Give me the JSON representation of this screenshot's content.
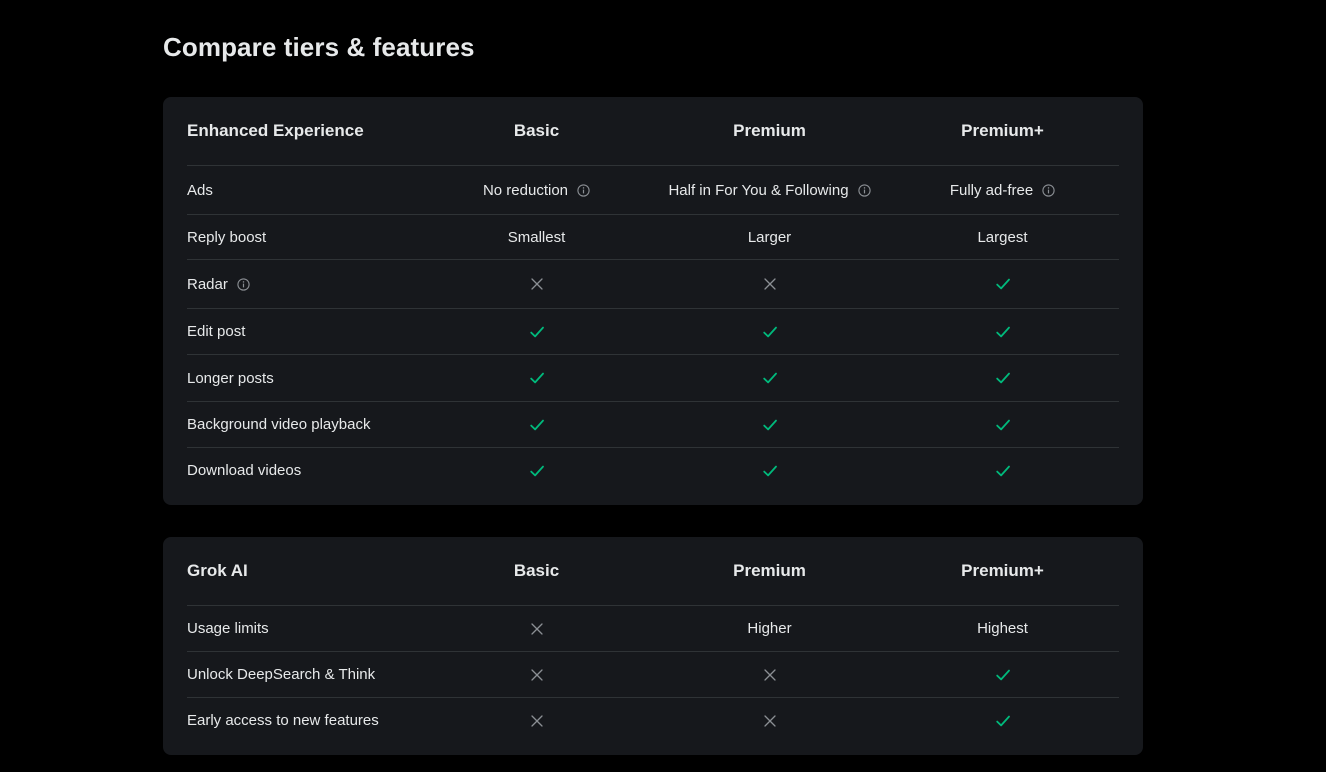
{
  "page_title": "Compare tiers & features",
  "colors": {
    "background": "#000000",
    "card": "#16181c",
    "divider": "#2f3336",
    "text": "#e7e9ea",
    "check": "#00ba7c",
    "cross": "#8b8f94"
  },
  "sections": [
    {
      "title": "Enhanced Experience",
      "columns": [
        "Basic",
        "Premium",
        "Premium+"
      ],
      "rows": [
        {
          "feature": "Ads",
          "info": false,
          "cells": [
            {
              "type": "text",
              "text": "No reduction",
              "info": true
            },
            {
              "type": "text",
              "text": "Half in For You & Following",
              "info": true
            },
            {
              "type": "text",
              "text": "Fully ad-free",
              "info": true
            }
          ]
        },
        {
          "feature": "Reply boost",
          "info": false,
          "cells": [
            {
              "type": "text",
              "text": "Smallest",
              "info": false
            },
            {
              "type": "text",
              "text": "Larger",
              "info": false
            },
            {
              "type": "text",
              "text": "Largest",
              "info": false
            }
          ]
        },
        {
          "feature": "Radar",
          "info": true,
          "cells": [
            {
              "type": "cross",
              "icon": "x-icon"
            },
            {
              "type": "cross",
              "icon": "x-icon"
            },
            {
              "type": "check",
              "icon": "check-icon"
            }
          ]
        },
        {
          "feature": "Edit post",
          "info": false,
          "cells": [
            {
              "type": "check",
              "icon": "check-icon"
            },
            {
              "type": "check",
              "icon": "check-icon"
            },
            {
              "type": "check",
              "icon": "check-icon"
            }
          ]
        },
        {
          "feature": "Longer posts",
          "info": false,
          "cells": [
            {
              "type": "check",
              "icon": "check-icon"
            },
            {
              "type": "check",
              "icon": "check-icon"
            },
            {
              "type": "check",
              "icon": "check-icon"
            }
          ]
        },
        {
          "feature": "Background video playback",
          "info": false,
          "cells": [
            {
              "type": "check",
              "icon": "check-icon"
            },
            {
              "type": "check",
              "icon": "check-icon"
            },
            {
              "type": "check",
              "icon": "check-icon"
            }
          ]
        },
        {
          "feature": "Download videos",
          "info": false,
          "cells": [
            {
              "type": "check",
              "icon": "check-icon"
            },
            {
              "type": "check",
              "icon": "check-icon"
            },
            {
              "type": "check",
              "icon": "check-icon"
            }
          ]
        }
      ]
    },
    {
      "title": "Grok AI",
      "columns": [
        "Basic",
        "Premium",
        "Premium+"
      ],
      "rows": [
        {
          "feature": "Usage limits",
          "info": false,
          "cells": [
            {
              "type": "cross",
              "icon": "x-icon"
            },
            {
              "type": "text",
              "text": "Higher",
              "info": false
            },
            {
              "type": "text",
              "text": "Highest",
              "info": false
            }
          ]
        },
        {
          "feature": "Unlock DeepSearch & Think",
          "info": false,
          "cells": [
            {
              "type": "cross",
              "icon": "x-icon"
            },
            {
              "type": "cross",
              "icon": "x-icon"
            },
            {
              "type": "check",
              "icon": "check-icon"
            }
          ]
        },
        {
          "feature": "Early access to new features",
          "info": false,
          "cells": [
            {
              "type": "cross",
              "icon": "x-icon"
            },
            {
              "type": "cross",
              "icon": "x-icon"
            },
            {
              "type": "check",
              "icon": "check-icon"
            }
          ]
        }
      ]
    }
  ]
}
